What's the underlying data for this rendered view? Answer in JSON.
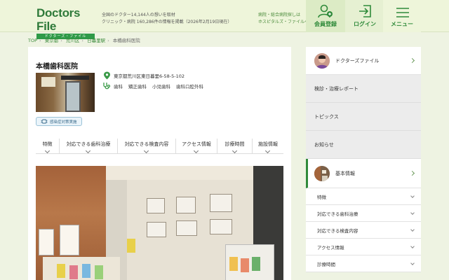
{
  "header": {
    "logo_title": "Doctors File",
    "logo_sub": "ドクターズ・ファイル",
    "tagline_1": "全国のドクター14,144人の想いを取材",
    "tagline_2": "クリニック・病院 160,286件の情報を掲載（2026年2月19日現在）",
    "hospital_link_1": "病院・総合病院探しは",
    "hospital_link_2": "ホスピタルズ・ファイルへ",
    "member_label": "会員登録",
    "login_label": "ログイン",
    "menu_label": "メニュー",
    "accent_color": "#2f8a3a"
  },
  "breadcrumb": [
    {
      "label": "TOP"
    },
    {
      "label": "東京都"
    },
    {
      "label": "荒川区"
    },
    {
      "label": "日暮里駅"
    },
    {
      "label": "本橋歯科医院"
    }
  ],
  "clinic": {
    "name": "本橋歯科医院",
    "address": "東京都荒川区東日暮里6-58-5-102",
    "departments": [
      "歯科",
      "矯正歯科",
      "小児歯科",
      "歯科口腔外科"
    ],
    "badge": "感染症対策実施"
  },
  "tabs": [
    "特徴",
    "対応できる歯科治療",
    "対応できる検査内容",
    "アクセス情報",
    "診療時間",
    "施設情報"
  ],
  "sidebar": {
    "doctors_file": "ドクターズファイル",
    "grey_items": [
      "検診・治療レポート",
      "トピックス",
      "お知らせ"
    ],
    "basic_info": "基本情報",
    "sub_items": [
      "特徴",
      "対応できる歯科治療",
      "対応できる検査内容",
      "アクセス情報",
      "診療時間"
    ]
  }
}
